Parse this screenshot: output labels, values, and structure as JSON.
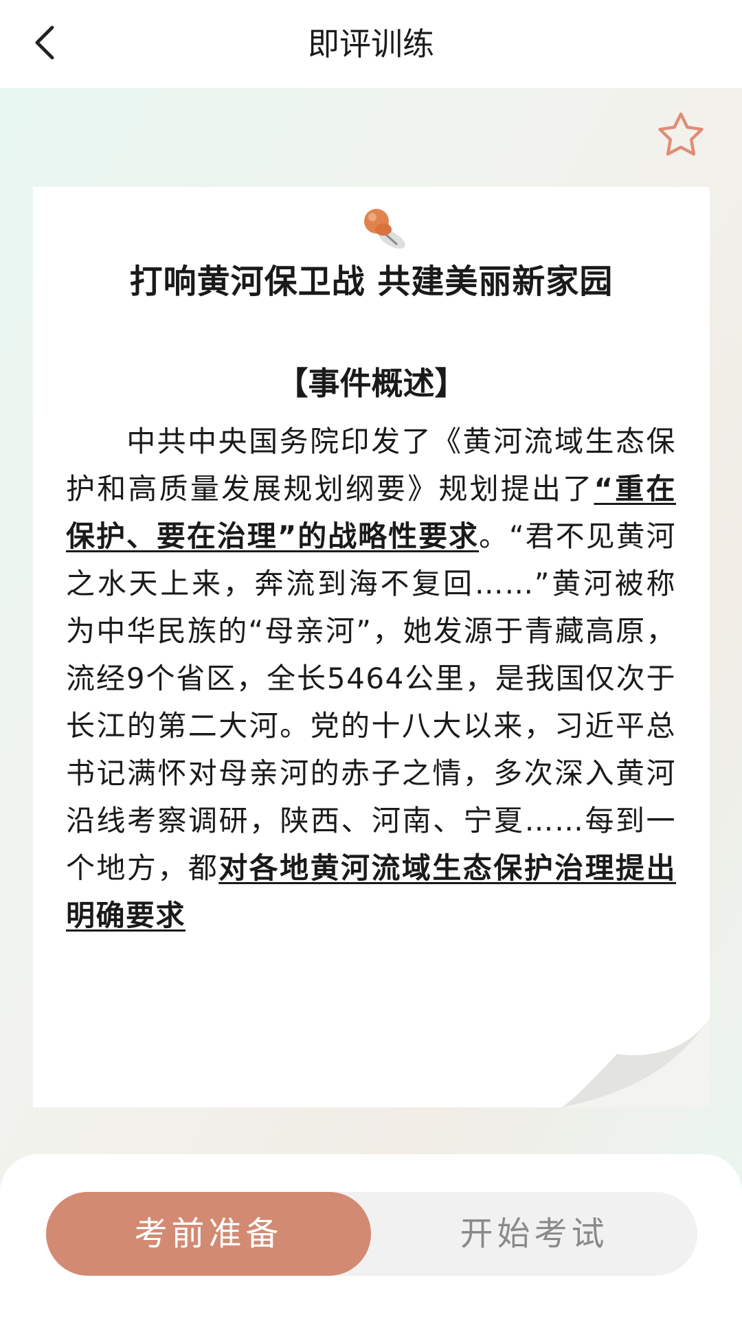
{
  "header": {
    "title": "即评训练",
    "back_icon": "chevron-left-icon"
  },
  "favorite_icon": "star-outline-icon",
  "colors": {
    "accent": "#d38a72",
    "star": "#e08d76",
    "pin": "#e2834f"
  },
  "article": {
    "title": "打响黄河保卫战 共建美丽新家园",
    "section_heading": "【事件概述】",
    "body_segments": [
      {
        "text": "中共中央国务院印发了《黄河流域生态保护和高质量发展规划纲要》规划提出了",
        "bold": false
      },
      {
        "text": "“重在保护、要在治理”的战略性要求",
        "bold": true
      },
      {
        "text": "。“君不见黄河之水天上来，奔流到海不复回……”黄河被称为中华民族的“母亲河”，她发源于青藏高原，流经9个省区，全长5464公里，是我国仅次于长江的第二大河。党的十八大以来，习近平总书记满怀对母亲河的赤子之情，多次深入黄河沿线考察调研，陕西、河南、宁夏……每到一个地方，都",
        "bold": false
      },
      {
        "text": "对各地黄河流域生态保护治理提出明确要求",
        "bold": true
      }
    ]
  },
  "tabs": {
    "prepare_label": "考前准备",
    "start_label": "开始考试"
  }
}
